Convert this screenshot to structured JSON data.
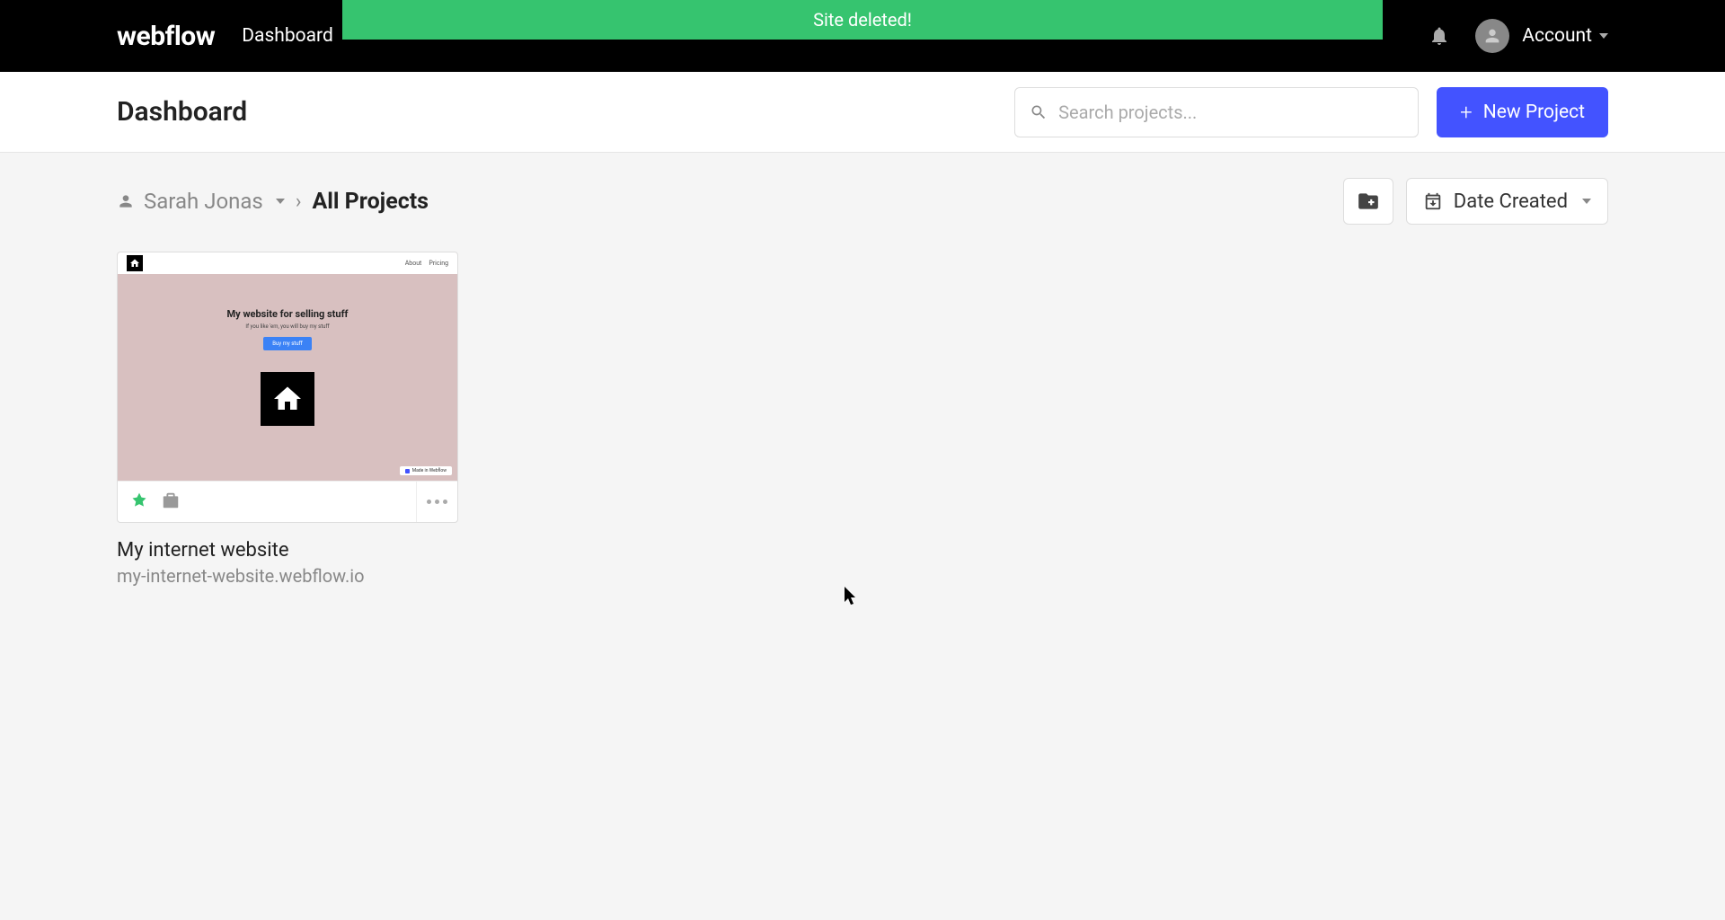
{
  "notification": {
    "message": "Site deleted!"
  },
  "topnav": {
    "logo": "webflow",
    "dashboard_link": "Dashboard",
    "account_label": "Account"
  },
  "header": {
    "title": "Dashboard",
    "search_placeholder": "Search projects...",
    "new_project_label": "New Project"
  },
  "breadcrumb": {
    "user_name": "Sarah Jonas",
    "current": "All Projects"
  },
  "sort": {
    "label": "Date Created"
  },
  "projects": [
    {
      "name": "My internet website",
      "url": "my-internet-website.webflow.io",
      "thumb": {
        "nav_about": "About",
        "nav_pricing": "Pricing",
        "headline": "My website for selling stuff",
        "sub": "If you like 'em, you will buy my stuff",
        "cta": "Buy my stuff",
        "badge": "Made in Webflow"
      }
    }
  ]
}
